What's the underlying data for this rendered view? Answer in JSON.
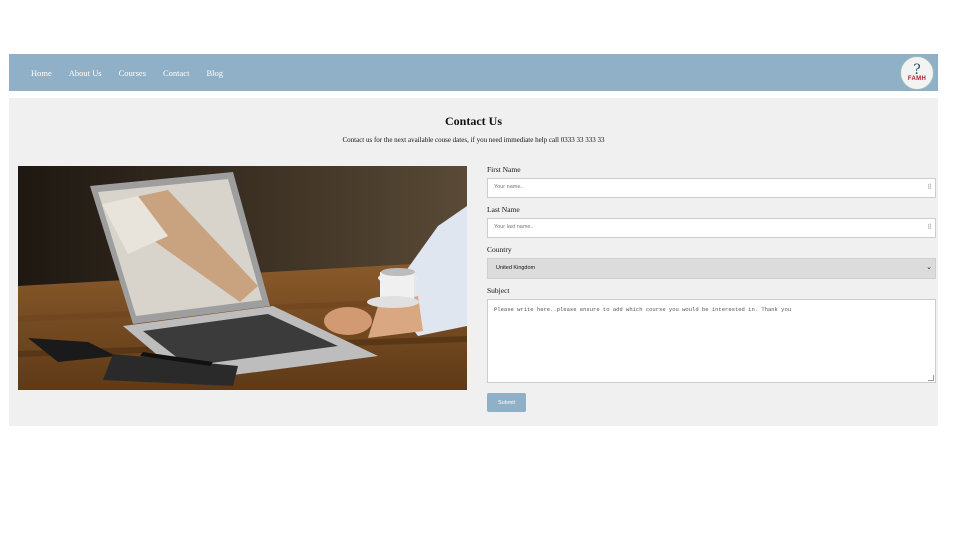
{
  "nav": {
    "items": [
      {
        "label": "Home"
      },
      {
        "label": "About Us"
      },
      {
        "label": "Courses"
      },
      {
        "label": "Contact"
      },
      {
        "label": "Blog"
      }
    ],
    "logo_text": "FAMH",
    "background": "#8fb0c6"
  },
  "main": {
    "title": "Contact Us",
    "subtitle": "Contact us for the next available couse dates, if you need immediate help call 0333 33 333 33",
    "image_icon": "handshake-laptop-photo"
  },
  "form": {
    "first_name": {
      "label": "First Name",
      "placeholder": "Your name.."
    },
    "last_name": {
      "label": "Last Name",
      "placeholder": "Your last name.."
    },
    "country": {
      "label": "Country",
      "value": "United Kingdom"
    },
    "subject": {
      "label": "Subject",
      "placeholder": "Please write here..please ensure to add which course you would be interested in. Thank you"
    },
    "submit_label": "Submit"
  }
}
